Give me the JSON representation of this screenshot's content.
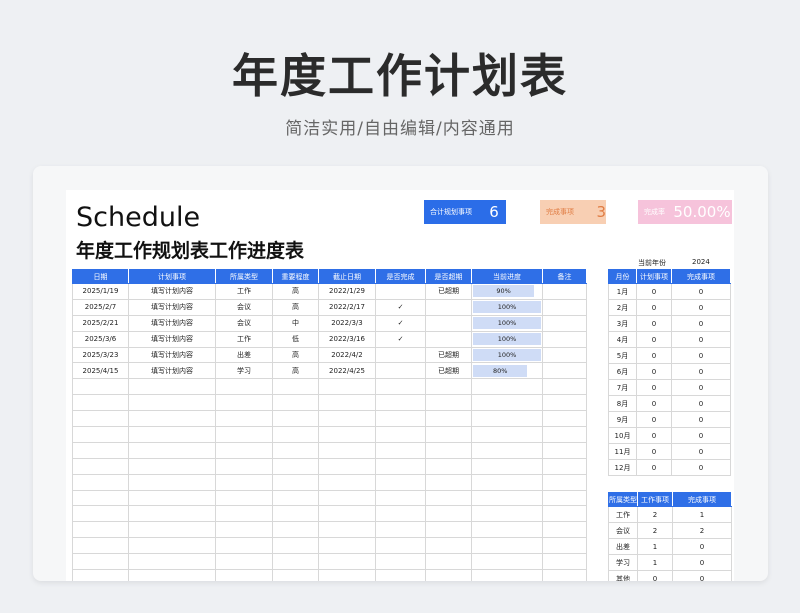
{
  "hero": {
    "title": "年度工作计划表",
    "subtitle": "简洁实用/自由编辑/内容通用"
  },
  "sheet": {
    "schedule_word": "Schedule",
    "title": "年度工作规划表工作进度表"
  },
  "kpis": {
    "plan": {
      "label": "合计规划事项",
      "value": "6"
    },
    "done": {
      "label": "完成事项",
      "value": "3"
    },
    "rate": {
      "label": "完成率",
      "value": "50.00%"
    }
  },
  "main_table": {
    "headers": [
      "日期",
      "计划事项",
      "所属类型",
      "重要程度",
      "截止日期",
      "是否完成",
      "是否超期",
      "当前进度",
      "备注"
    ],
    "rows": [
      {
        "date": "2025/1/19",
        "item": "填写计划内容",
        "type": "工作",
        "priority": "高",
        "deadline": "2022/1/29",
        "done": "",
        "overdue": "已超期",
        "progress": "90%",
        "note": ""
      },
      {
        "date": "2025/2/7",
        "item": "填写计划内容",
        "type": "会议",
        "priority": "高",
        "deadline": "2022/2/17",
        "done": "✓",
        "overdue": "",
        "progress": "100%",
        "note": ""
      },
      {
        "date": "2025/2/21",
        "item": "填写计划内容",
        "type": "会议",
        "priority": "中",
        "deadline": "2022/3/3",
        "done": "✓",
        "overdue": "",
        "progress": "100%",
        "note": ""
      },
      {
        "date": "2025/3/6",
        "item": "填写计划内容",
        "type": "工作",
        "priority": "低",
        "deadline": "2022/3/16",
        "done": "✓",
        "overdue": "",
        "progress": "100%",
        "note": ""
      },
      {
        "date": "2025/3/23",
        "item": "填写计划内容",
        "type": "出差",
        "priority": "高",
        "deadline": "2022/4/2",
        "done": "",
        "overdue": "已超期",
        "progress": "100%",
        "note": ""
      },
      {
        "date": "2025/4/15",
        "item": "填写计划内容",
        "type": "学习",
        "priority": "高",
        "deadline": "2022/4/25",
        "done": "",
        "overdue": "已超期",
        "progress": "80%",
        "note": ""
      }
    ],
    "progress_values": [
      0.9,
      1.0,
      1.0,
      1.0,
      1.0,
      0.8
    ]
  },
  "year": {
    "label": "当前年份",
    "value": "2024"
  },
  "month_table": {
    "headers": [
      "月份",
      "计划事项",
      "完成事项"
    ],
    "rows": [
      [
        "1月",
        "0",
        "0"
      ],
      [
        "2月",
        "0",
        "0"
      ],
      [
        "3月",
        "0",
        "0"
      ],
      [
        "4月",
        "0",
        "0"
      ],
      [
        "5月",
        "0",
        "0"
      ],
      [
        "6月",
        "0",
        "0"
      ],
      [
        "7月",
        "0",
        "0"
      ],
      [
        "8月",
        "0",
        "0"
      ],
      [
        "9月",
        "0",
        "0"
      ],
      [
        "10月",
        "0",
        "0"
      ],
      [
        "11月",
        "0",
        "0"
      ],
      [
        "12月",
        "0",
        "0"
      ]
    ]
  },
  "type_table": {
    "headers": [
      "所属类型",
      "工作事项",
      "完成事项"
    ],
    "rows": [
      [
        "工作",
        "2",
        "1"
      ],
      [
        "会议",
        "2",
        "2"
      ],
      [
        "出差",
        "1",
        "0"
      ],
      [
        "学习",
        "1",
        "0"
      ],
      [
        "其他",
        "0",
        "0"
      ]
    ]
  },
  "colors": {
    "header_blue": "#2f6fe7",
    "plan_kpi": "#2b6de8",
    "done_kpi": "#f8cfb3",
    "rate_kpi": "#f6c3db",
    "progress_fill": "#cfdcf6"
  }
}
